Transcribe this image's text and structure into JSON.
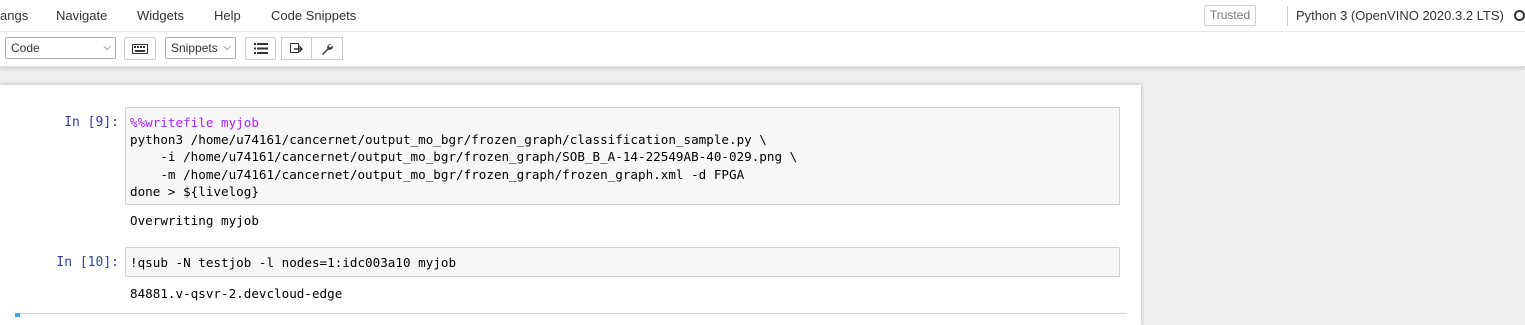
{
  "menubar": {
    "items": [
      "angs",
      "Navigate",
      "Widgets",
      "Help",
      "Code Snippets"
    ],
    "trusted": "Trusted",
    "kernel": "Python 3 (OpenVINO 2020.3.2 LTS)"
  },
  "toolbar": {
    "cell_type": "Code",
    "snippets": "Snippets"
  },
  "cells": [
    {
      "prompt": "In [9]:",
      "code_lines": [
        "%%writefile myjob",
        "python3 /home/u74161/cancernet/output_mo_bgr/frozen_graph/classification_sample.py \\",
        "    -i /home/u74161/cancernet/output_mo_bgr/frozen_graph/SOB_B_A-14-22549AB-40-029.png \\",
        "    -m /home/u74161/cancernet/output_mo_bgr/frozen_graph/frozen_graph.xml -d FPGA",
        "done > ${livelog}"
      ],
      "output": "Overwriting myjob"
    },
    {
      "prompt": "In [10]:",
      "code_lines": [
        "!qsub -N testjob -l nodes=1:idc003a10 myjob"
      ],
      "output": "84881.v-qsvr-2.devcloud-edge"
    }
  ],
  "colors": {
    "prompt": "#303f9f",
    "magic": "#aa22ff",
    "number": "#008800",
    "variable": "#ba2121",
    "cell_bg": "#f7f7f7",
    "selected_accent": "#42a5f5"
  }
}
